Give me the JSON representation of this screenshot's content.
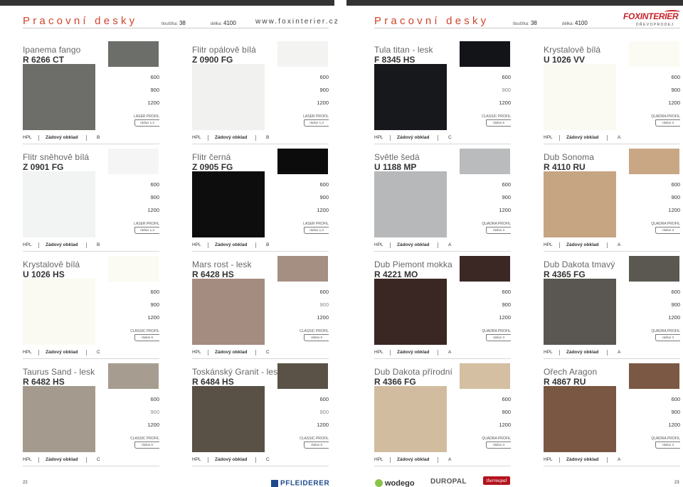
{
  "header": {
    "title_left": "Pracovní desky",
    "title_right": "Pracovní desky",
    "thickness_label": "tloušťka:",
    "thickness_value": "38",
    "length_label": "délka:",
    "length_value": "4100",
    "url": "www.foxinterier.cz",
    "logo_text": "FOXINTERIER",
    "logo_sub": "DŘEVOPRODEJ"
  },
  "footer": {
    "page_left": "22",
    "page_right": "23",
    "brands": [
      "PFLEIDERER",
      "wodego",
      "DUROPAL",
      "thermopal"
    ]
  },
  "products": [
    {
      "name": "Ipanema fango",
      "code": "R 6266 CT",
      "sizes": [
        "600",
        "900",
        "1200"
      ],
      "profile": "LASER PROFIL",
      "radius": "rádius 1,3",
      "tags": [
        "HPL",
        "Zádový obklad",
        "B"
      ],
      "chip": "#6c6e6a",
      "big": "#6d6e6a"
    },
    {
      "name": "Flitr opálově bílá",
      "code": "Z 0900 FG",
      "sizes": [
        "600",
        "900",
        "1200"
      ],
      "profile": "LASER PROFIL",
      "radius": "rádius 1,3",
      "tags": [
        "HPL",
        "Zádový obklad",
        "B"
      ],
      "chip": "#f3f3f2",
      "big": "#f1f1f0"
    },
    {
      "name": "Tula titan - lesk",
      "code": "F 8345 HS",
      "sizes": [
        "600",
        "900",
        "1200"
      ],
      "profile": "CLASSIC PROFIL",
      "radius": "rádius 6",
      "tags": [
        "HPL",
        "Zádový obklad",
        "C"
      ],
      "chip": "#121418",
      "big": "#16181c"
    },
    {
      "name": "Krystalově bílá",
      "code": "U 1026 VV",
      "sizes": [
        "600",
        "900",
        "1200"
      ],
      "profile": "QUADRA PROFIL",
      "radius": "rádius 3",
      "tags": [
        "HPL",
        "Zádový obklad",
        "A"
      ],
      "chip": "#fbfaf3",
      "big": "#fbfaf2"
    },
    {
      "name": "Flitr sněhově bílá",
      "code": "Z 0901 FG",
      "sizes": [
        "600",
        "900",
        "1200"
      ],
      "profile": "LASER PROFIL",
      "radius": "rádius 1,3",
      "tags": [
        "HPL",
        "Zádový obklad",
        "B"
      ],
      "chip": "#f5f5f5",
      "big": "#f2f3f3"
    },
    {
      "name": "Flitr černá",
      "code": "Z 0905 FG",
      "sizes": [
        "600",
        "900",
        "1200"
      ],
      "profile": "LASER PROFIL",
      "radius": "rádius 1,3",
      "tags": [
        "HPL",
        "Zádový obklad",
        "B"
      ],
      "chip": "#0b0c0b",
      "big": "#0d0d0d"
    },
    {
      "name": "Světle šedá",
      "code": "U 1188 MP",
      "sizes": [
        "600",
        "900",
        "1200"
      ],
      "profile": "QUADRA PROFIL",
      "radius": "rádius 3",
      "tags": [
        "HPL",
        "Zádový obklad",
        "A"
      ],
      "chip": "#b9bbbc",
      "big": "#b6b8b9"
    },
    {
      "name": "Dub Sonoma",
      "code": "R 4110 RU",
      "sizes": [
        "600",
        "900",
        "1200"
      ],
      "profile": "QUADRA PROFIL",
      "radius": "rádius 3",
      "tags": [
        "HPL",
        "Zádový obklad",
        "A"
      ],
      "chip": "#c9a784",
      "big": "#c6a583"
    },
    {
      "name": "Krystalově bílá",
      "code": "U 1026 HS",
      "sizes": [
        "600",
        "900",
        "1200"
      ],
      "profile": "CLASSIC PROFIL",
      "radius": "rádius 6",
      "tags": [
        "HPL",
        "Zádový obklad",
        "C"
      ],
      "chip": "#fbfaf3",
      "big": "#fbfaf2"
    },
    {
      "name": "Mars rost - lesk",
      "code": "R 6428 HS",
      "sizes": [
        "600",
        "900",
        "1200"
      ],
      "profile": "CLASSIC PROFIL",
      "radius": "rádius 6",
      "tags": [
        "HPL",
        "Zádový obklad",
        "C"
      ],
      "chip": "#a58f83",
      "big": "#a48c80"
    },
    {
      "name": "Dub Piemont mokka",
      "code": "R 4221 MO",
      "sizes": [
        "600",
        "900",
        "1200"
      ],
      "profile": "QUADRA PROFIL",
      "radius": "rádius 3",
      "tags": [
        "HPL",
        "Zádový obklad",
        "A"
      ],
      "chip": "#3b2824",
      "big": "#3a2723"
    },
    {
      "name": "Dub Dakota tmavý",
      "code": "R 4365 FG",
      "sizes": [
        "600",
        "900",
        "1200"
      ],
      "profile": "QUADRA PROFIL",
      "radius": "rádius 3",
      "tags": [
        "HPL",
        "Zádový obklad",
        "A"
      ],
      "chip": "#5b5852",
      "big": "#5a5752"
    },
    {
      "name": "Taurus Sand - lesk",
      "code": "R 6482 HS",
      "sizes": [
        "600",
        "900",
        "1200"
      ],
      "profile": "CLASSIC PROFIL",
      "radius": "rádius 6",
      "tags": [
        "HPL",
        "Zádový obklad",
        "C"
      ],
      "chip": "#a69d90",
      "big": "#a49b8e"
    },
    {
      "name": "Toskánský Granit - lesk",
      "code": "R 6484 HS",
      "sizes": [
        "600",
        "900",
        "1200"
      ],
      "profile": "CLASSIC PROFIL",
      "radius": "rádius 6",
      "tags": [
        "HPL",
        "Zádový obklad",
        "C"
      ],
      "chip": "#5a5246",
      "big": "#595145"
    },
    {
      "name": "Dub Dakota přírodní",
      "code": "R 4366 FG",
      "sizes": [
        "600",
        "900",
        "1200"
      ],
      "profile": "QUADRA PROFIL",
      "radius": "rádius 3",
      "tags": [
        "HPL",
        "Zádový obklad",
        "A"
      ],
      "chip": "#d4bfa2",
      "big": "#d2bc9f"
    },
    {
      "name": "Ořech Aragon",
      "code": "R 4867 RU",
      "sizes": [
        "600",
        "900",
        "1200"
      ],
      "profile": "QUADRA PROFIL",
      "radius": "rádius 3",
      "tags": [
        "HPL",
        "Zádový obklad",
        "A"
      ],
      "chip": "#7a5844",
      "big": "#7a5742"
    }
  ]
}
